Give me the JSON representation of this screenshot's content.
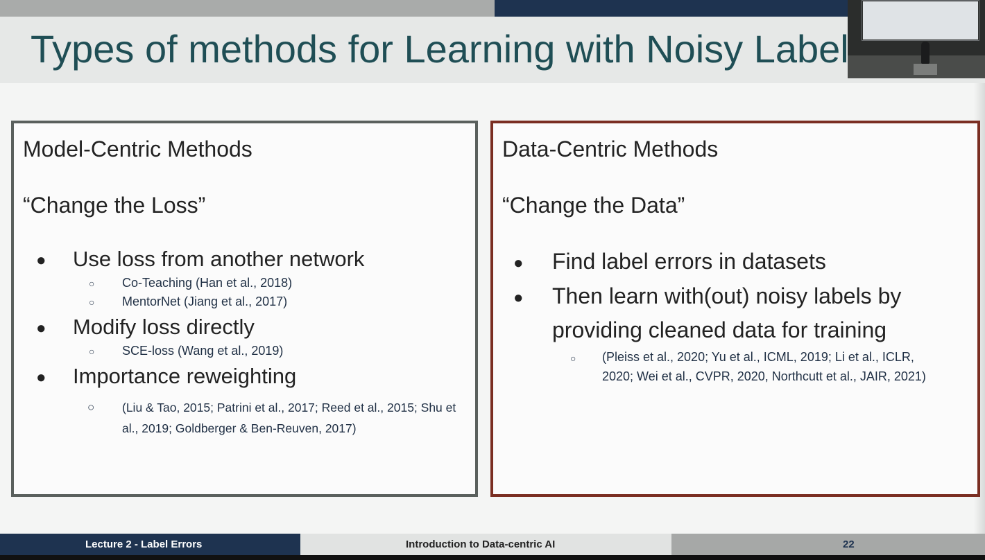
{
  "slide": {
    "title": "Types of methods for Learning with Noisy Label",
    "left_panel": {
      "heading": "Model-Centric Methods",
      "tagline": "“Change the Loss”",
      "bullets": [
        {
          "text": "Use loss from another network"
        },
        {
          "text": "Modify loss directly"
        },
        {
          "text": "Importance reweighting"
        }
      ],
      "subs": [
        "Co-Teaching (Han et al., 2018)",
        "MentorNet (Jiang et al., 2017)",
        "SCE-loss (Wang et al., 2019)",
        "(Liu & Tao, 2015; Patrini et al., 2017; Reed et al., 2015; Shu et",
        "al., 2019; Goldberger & Ben-Reuven, 2017)"
      ]
    },
    "right_panel": {
      "heading": "Data-Centric Methods",
      "tagline": "“Change the Data”",
      "bullets": [
        "Find label errors in datasets",
        "Then learn with(out) noisy labels by",
        "providing cleaned data for training"
      ],
      "subs": [
        "(Pleiss et al., 2020; Yu et al., ICML, 2019; Li et al., ICLR,",
        "2020; Wei et al., CVPR, 2020, Northcutt et al., JAIR, 2021)"
      ]
    },
    "footer": {
      "left": "Lecture 2 - Label Errors",
      "center": "Introduction to Data-centric AI",
      "page": "22"
    },
    "glyphs": {
      "bullet": "●",
      "sub_bullet": "○"
    },
    "colors": {
      "title": "#1f4e55",
      "left_border": "#5a605d",
      "right_border": "#7a2e22",
      "footer_navy": "#1e3350"
    }
  }
}
